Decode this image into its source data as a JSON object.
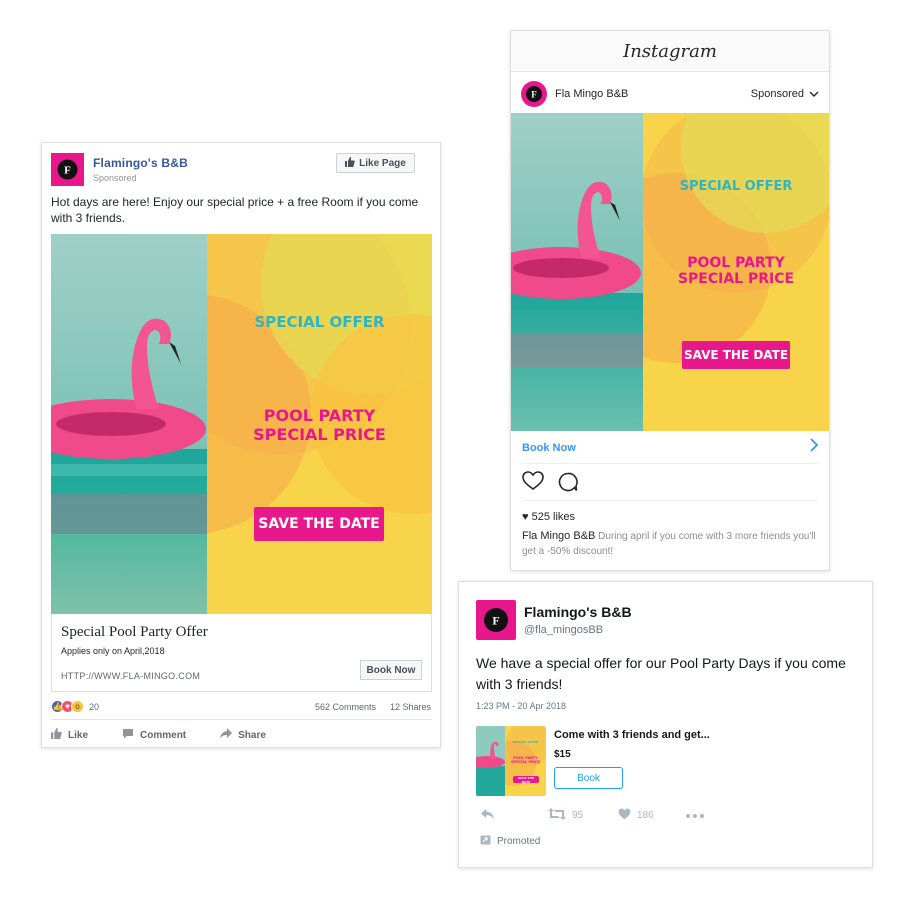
{
  "colors": {
    "brand_pink": "#e8188c",
    "ad_yellow": "#f7d449",
    "ad_teal": "#2cb6c4",
    "fb_blue": "#365899",
    "ig_blue": "#3897f0",
    "tw_blue": "#1da1f2"
  },
  "creative": {
    "special_offer": "SPECIAL OFFER",
    "pool_party_line1": "POOL PARTY",
    "pool_party_line2": "SPECIAL PRICE",
    "save_the_date": "SAVE THE DATE"
  },
  "facebook": {
    "avatar_letter": "F",
    "page_name": "Flamingo's B&B",
    "sponsored": "Sponsored",
    "like_page": "Like Page",
    "post_text": "Hot days are here! Enjoy our special price + a free Room if you come with 3 friends.",
    "link_title": "Special Pool Party Offer",
    "link_subtitle": "Applies only on April,2018",
    "link_url": "HTTP://WWW.FLA-MINGO.COM",
    "book_now": "Book Now",
    "reaction_count": "20",
    "comments": "562 Comments",
    "shares": "12 Shares",
    "action_like": "Like",
    "action_comment": "Comment",
    "action_share": "Share",
    "icons": [
      "thumbs-up-icon",
      "comment-icon",
      "share-icon",
      "like-reaction-icon",
      "love-reaction-icon",
      "wow-reaction-icon"
    ]
  },
  "instagram": {
    "title": "Instagram",
    "avatar_letter": "F",
    "account": "Fla Mingo B&B",
    "sponsored": "Sponsored",
    "book_now": "Book Now",
    "likes": "♥ 525 likes",
    "caption_account": "Fla Mingo B&B",
    "caption_text": "During april if you come with 3 more friends you'll get a -50% discount!",
    "icons": [
      "heart-icon",
      "comment-bubble-icon",
      "chevron-right-icon",
      "chevron-down-icon"
    ]
  },
  "twitter": {
    "avatar_letter": "F",
    "name": "Flamingo's B&B",
    "handle": "@fla_mingosBB",
    "tweet": "We have a special offer for our Pool Party Days if you come with 3 friends!",
    "time": "1:23 PM - 20 Apr 2018",
    "card_title": "Come with 3 friends and get...",
    "card_price": "$15",
    "book": "Book",
    "retweets": "95",
    "likes": "186",
    "promoted": "Promoted",
    "icons": [
      "reply-icon",
      "retweet-icon",
      "like-heart-icon",
      "more-icon",
      "promoted-icon"
    ]
  }
}
